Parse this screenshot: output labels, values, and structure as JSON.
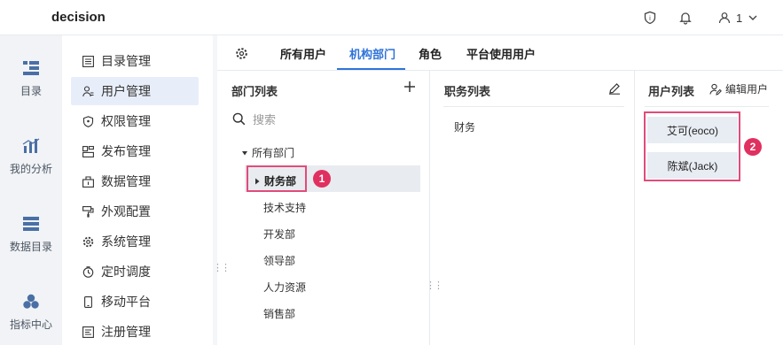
{
  "topbar": {
    "app_name": "decision",
    "user_name": "1"
  },
  "leftnav": [
    {
      "label": "目录",
      "icon": "directory-icon"
    },
    {
      "label": "我的分析",
      "icon": "analysis-icon"
    },
    {
      "label": "数据目录",
      "icon": "data-catalog-icon"
    },
    {
      "label": "指标中心",
      "icon": "metric-center-icon"
    }
  ],
  "subnav": [
    {
      "label": "目录管理",
      "icon": "catalog-manage-icon"
    },
    {
      "label": "用户管理",
      "icon": "user-manage-icon",
      "active": true
    },
    {
      "label": "权限管理",
      "icon": "permission-icon"
    },
    {
      "label": "发布管理",
      "icon": "publish-icon"
    },
    {
      "label": "数据管理",
      "icon": "data-manage-icon"
    },
    {
      "label": "外观配置",
      "icon": "appearance-icon"
    },
    {
      "label": "系统管理",
      "icon": "system-icon"
    },
    {
      "label": "定时调度",
      "icon": "schedule-icon"
    },
    {
      "label": "移动平台",
      "icon": "mobile-icon"
    },
    {
      "label": "注册管理",
      "icon": "register-icon"
    }
  ],
  "tabs": [
    {
      "label": "所有用户"
    },
    {
      "label": "机构部门",
      "active": true
    },
    {
      "label": "角色"
    },
    {
      "label": "平台使用用户"
    }
  ],
  "dept_panel": {
    "title": "部门列表",
    "search_placeholder": "搜索",
    "root": "所有部门",
    "nodes": [
      "财务部",
      "技术支持",
      "开发部",
      "领导部",
      "人力资源",
      "销售部"
    ]
  },
  "post_panel": {
    "title": "职务列表",
    "items": [
      "财务"
    ]
  },
  "user_panel": {
    "title": "用户列表",
    "edit_label": "编辑用户",
    "users": [
      "艾可(eoco)",
      "陈斌(Jack)"
    ]
  },
  "badges": [
    "1",
    "2"
  ],
  "colors": {
    "accent": "#2f73d9",
    "highlight": "#e24b7a",
    "badge": "#e0305f"
  }
}
